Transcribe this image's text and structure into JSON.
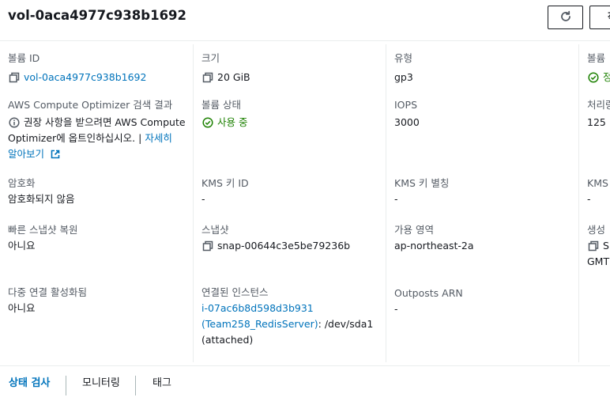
{
  "header": {
    "title": "vol-0aca4977c938b1692",
    "next_button_label": "작"
  },
  "fields": {
    "volume_id": {
      "label": "볼륨 ID",
      "value": "vol-0aca4977c938b1692"
    },
    "size": {
      "label": "크기",
      "value": "20 GiB"
    },
    "type": {
      "label": "유형",
      "value": "gp3"
    },
    "volume_status_col4": {
      "label": "볼륨",
      "value": "정"
    },
    "optimizer": {
      "label": "AWS Compute Optimizer 검색 결과",
      "line1": "권장 사항을 받으려면 AWS Compute",
      "line2": "Optimizer에 옵트인하십시오. | ",
      "link1": "자세히",
      "link2": "알아보기"
    },
    "volume_state": {
      "label": "볼륨 상태",
      "value": "사용 중"
    },
    "iops": {
      "label": "IOPS",
      "value": "3000"
    },
    "throughput": {
      "label": "처리량",
      "value": "125"
    },
    "encryption": {
      "label": "암호화",
      "value": "암호화되지 않음"
    },
    "kms_key_id": {
      "label": "KMS 키 ID",
      "value": "-"
    },
    "kms_alias": {
      "label": "KMS 키 별칭",
      "value": "-"
    },
    "kms_col4": {
      "label": "KMS",
      "value": "-"
    },
    "fast_snapshot_restore": {
      "label": "빠른 스냅샷 복원",
      "value": "아니요"
    },
    "snapshot": {
      "label": "스냅샷",
      "value": "snap-00644c3e5be79236b"
    },
    "availability_zone": {
      "label": "가용 영역",
      "value": "ap-northeast-2a"
    },
    "created": {
      "label": "생성",
      "value1": "S",
      "value2": "GMT+"
    },
    "multi_attach": {
      "label": "다중 연결 활성화됨",
      "value": "아니요"
    },
    "attached_instances": {
      "label": "연결된 인스턴스",
      "link1": "i-07ac6b8d598d3b931",
      "link2": "(Team258_RedisServer)",
      "suffix": ": /dev/sda1",
      "line3": "(attached)"
    },
    "outposts_arn": {
      "label": "Outposts ARN",
      "value": "-"
    }
  },
  "tabs": [
    {
      "label": "상태 검사",
      "active": true
    },
    {
      "label": "모니터링",
      "active": false
    },
    {
      "label": "태그",
      "active": false
    }
  ],
  "colors": {
    "link": "#0073bb",
    "success": "#1d8102",
    "label": "#545b64",
    "text": "#16191f"
  },
  "icons": {
    "copy": "copy-icon",
    "refresh": "refresh-icon",
    "status": "check-circle-icon",
    "info": "info-icon",
    "external": "external-link-icon"
  }
}
